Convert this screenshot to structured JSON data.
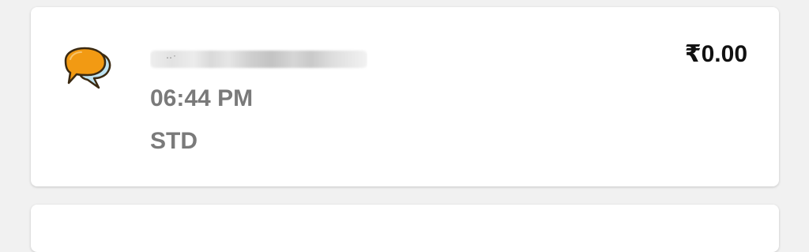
{
  "call_log": {
    "entry": {
      "contact_name": "",
      "time": "06:44 PM",
      "call_type": "STD",
      "amount": "₹0.00",
      "icon": "chat-bubbles-icon"
    }
  },
  "colors": {
    "bubble_front": "#f29a13",
    "bubble_back": "#bfe3f2",
    "outline": "#3b2a12",
    "secondary_text": "#7a7a7a",
    "amount_text": "#111111",
    "background": "#f1f1f1"
  }
}
